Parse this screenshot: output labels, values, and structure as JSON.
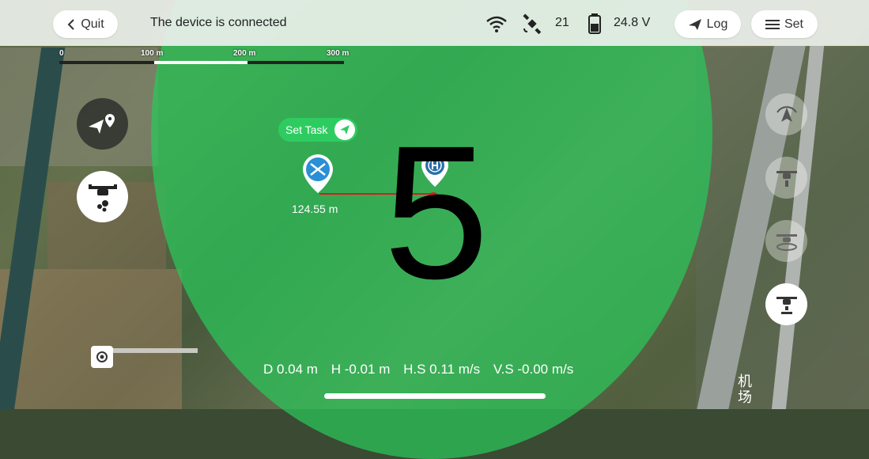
{
  "topbar": {
    "quit_label": "Quit",
    "connection_status": "The device is connected",
    "satellite_count": "21",
    "battery_voltage": "24.8 V",
    "log_label": "Log",
    "set_label": "Set"
  },
  "map": {
    "scale_ticks": [
      "0",
      "100 m",
      "200 m",
      "300 m"
    ],
    "set_task_label": "Set Task",
    "distance_label": "124.55 m",
    "countdown": "5",
    "roadside_text": "机场"
  },
  "telemetry": {
    "distance": "D 0.04 m",
    "height": "H -0.01 m",
    "horizontal_speed": "H.S 0.11 m/s",
    "vertical_speed": "V.S -0.00 m/s"
  },
  "colors": {
    "coverage_circle": "#2ac85a",
    "marker_blue": "#2b8fd6",
    "route_line": "#d02020"
  }
}
